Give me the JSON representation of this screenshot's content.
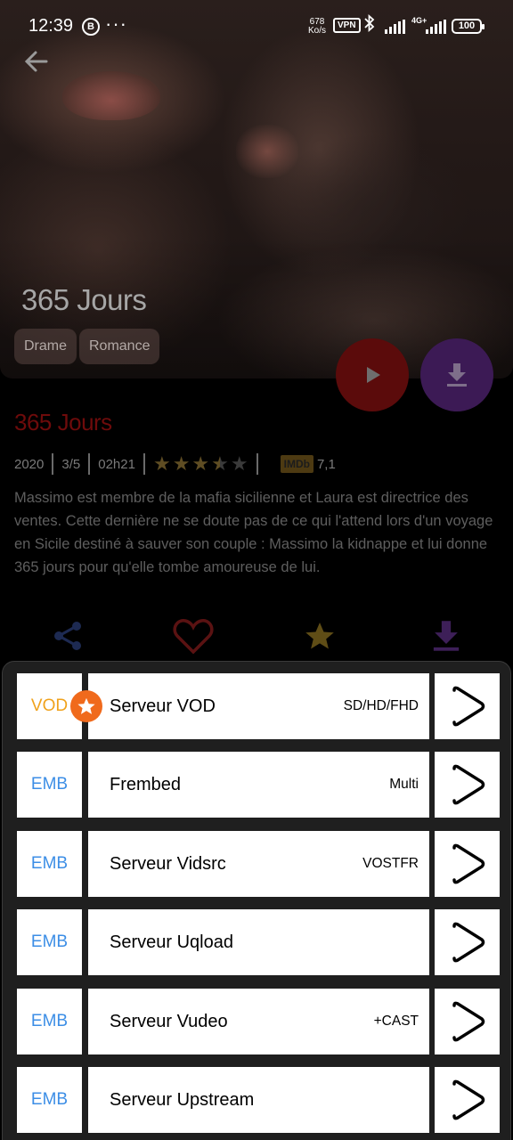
{
  "status_bar": {
    "time": "12:39",
    "b_badge": "B",
    "more": "···",
    "speed_value": "678",
    "speed_unit": "Ko/s",
    "vpn": "VPN",
    "network": "4G+",
    "battery": "100"
  },
  "hero": {
    "title": "365 Jours",
    "genres": [
      "Drame",
      "Romance"
    ]
  },
  "movie": {
    "title": "365 Jours",
    "year": "2020",
    "rating": "3/5",
    "duration": "02h21",
    "stars_value": 3.5,
    "stars_max": 5,
    "imdb_label": "IMDb",
    "imdb_score": "7,1",
    "description": "Massimo est membre de la mafia sicilienne et Laura est directrice des ventes. Cette dernière ne se doute pas de ce qui l'attend lors d'un voyage en Sicile destiné à sauver son couple : Massimo la kidnappe et lui donne 365 jours pour qu'elle tombe amoureuse de lui."
  },
  "colors": {
    "vod": "#f0a21c",
    "emb": "#3c8ee6",
    "play_fab": "#5b0b0b",
    "download_fab": "#3c1a55",
    "title_red": "#6e0b0b",
    "badge_orange": "#f06a1c"
  },
  "servers": [
    {
      "tag": "VOD",
      "name": "Serveur VOD",
      "quality": "SD/HD/FHD"
    },
    {
      "tag": "EMB",
      "name": "Frembed",
      "quality": "Multi"
    },
    {
      "tag": "EMB",
      "name": "Serveur Vidsrc",
      "quality": "VOSTFR"
    },
    {
      "tag": "EMB",
      "name": "Serveur Uqload",
      "quality": ""
    },
    {
      "tag": "EMB",
      "name": "Serveur Vudeo",
      "quality": "+CAST"
    },
    {
      "tag": "EMB",
      "name": "Serveur Upstream",
      "quality": ""
    }
  ],
  "icons": {
    "back": "arrow-left-icon",
    "play": "play-icon",
    "download": "download-icon",
    "share": "share-icon",
    "favorite": "heart-icon",
    "star": "star-icon",
    "server_go": "play-outline-icon"
  }
}
